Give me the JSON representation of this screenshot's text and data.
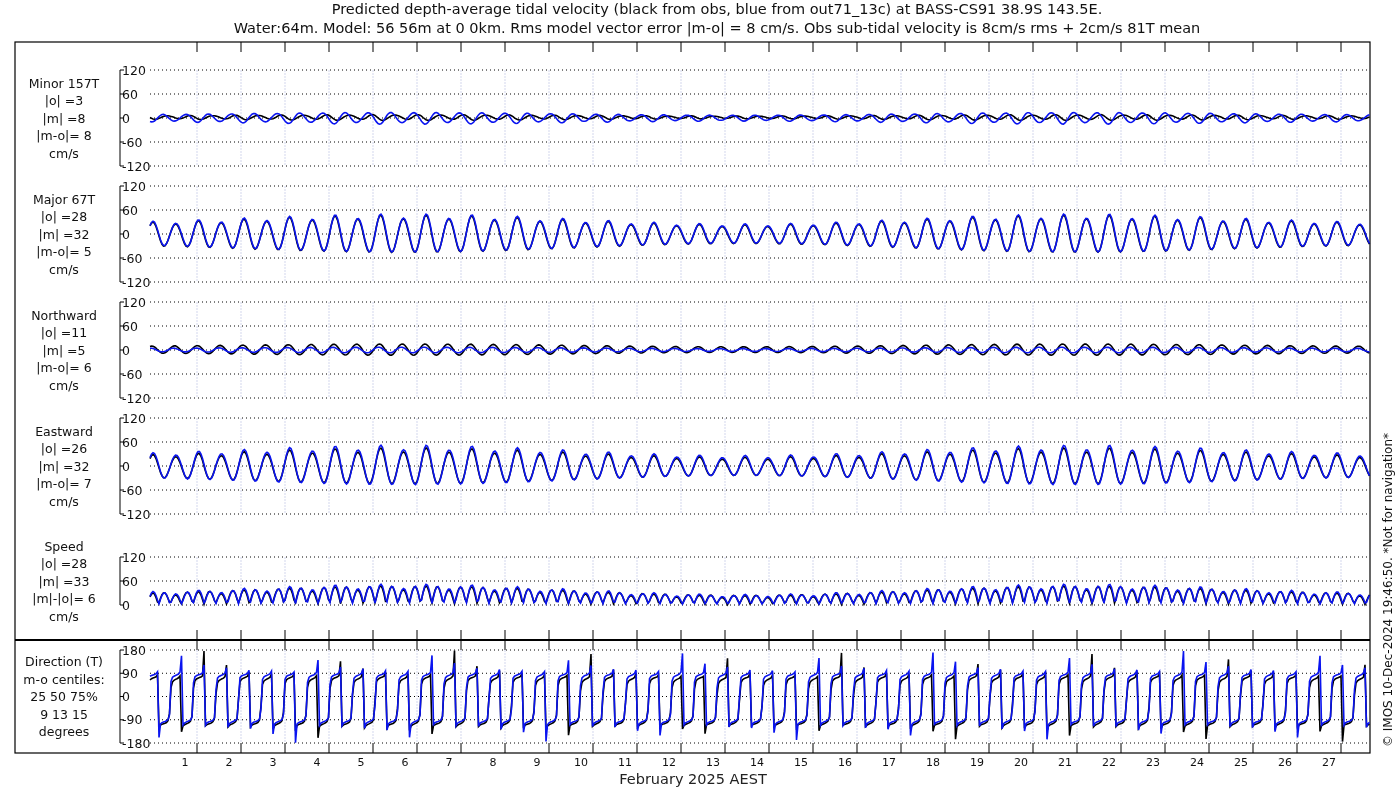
{
  "title_lines": [
    "Predicted depth-average tidal velocity (black from obs, blue from out71_13c) at BASS-CS91 38.9S 143.5E.",
    "Water:64m. Model: 56 56m at 0 0km. Rms model vector error |m-o| = 8 cm/s. Obs sub-tidal velocity is 8cm/s rms + 2cm/s 81T mean"
  ],
  "panels": [
    {
      "kind": "velocity",
      "label_lines": [
        "Minor 157T",
        "|o| =3",
        "|m| =8",
        "|m-o|= 8",
        "cm/s"
      ],
      "yticks": [
        "120",
        "60",
        "0",
        "-60",
        "-120"
      ]
    },
    {
      "kind": "velocity",
      "label_lines": [
        "Major 67T",
        "|o| =28",
        "|m| =32",
        "|m-o|= 5",
        "cm/s"
      ],
      "yticks": [
        "120",
        "60",
        "0",
        "-60",
        "-120"
      ]
    },
    {
      "kind": "velocity",
      "label_lines": [
        "Northward",
        "|o| =11",
        "|m| =5",
        "|m-o|= 6",
        "cm/s"
      ],
      "yticks": [
        "120",
        "60",
        "0",
        "-60",
        "-120"
      ]
    },
    {
      "kind": "velocity",
      "label_lines": [
        "Eastward",
        "|o| =26",
        "|m| =32",
        "|m-o|= 7",
        "cm/s"
      ],
      "yticks": [
        "120",
        "60",
        "0",
        "-60",
        "-120"
      ]
    },
    {
      "kind": "speed",
      "label_lines": [
        "Speed",
        "|o| =28",
        "|m| =33",
        "|m|-|o|= 6",
        "cm/s"
      ],
      "yticks": [
        "120",
        "60",
        "0"
      ]
    },
    {
      "kind": "direction",
      "label_lines": [
        "Direction (T)",
        "m-o centiles:",
        "25  50  75%",
        "9  13  15",
        "degrees"
      ],
      "yticks": [
        "180",
        "90",
        "0",
        "-90",
        "-180"
      ]
    }
  ],
  "x_axis": {
    "ticks": [
      "1",
      "2",
      "3",
      "4",
      "5",
      "6",
      "7",
      "8",
      "9",
      "10",
      "11",
      "12",
      "13",
      "14",
      "15",
      "16",
      "17",
      "18",
      "19",
      "20",
      "21",
      "22",
      "23",
      "24",
      "25",
      "26",
      "27"
    ],
    "label": "February 2025 AEST"
  },
  "footer": "© IMOS 10-Dec-2024 19:46:50.  *Not for navigation*"
}
